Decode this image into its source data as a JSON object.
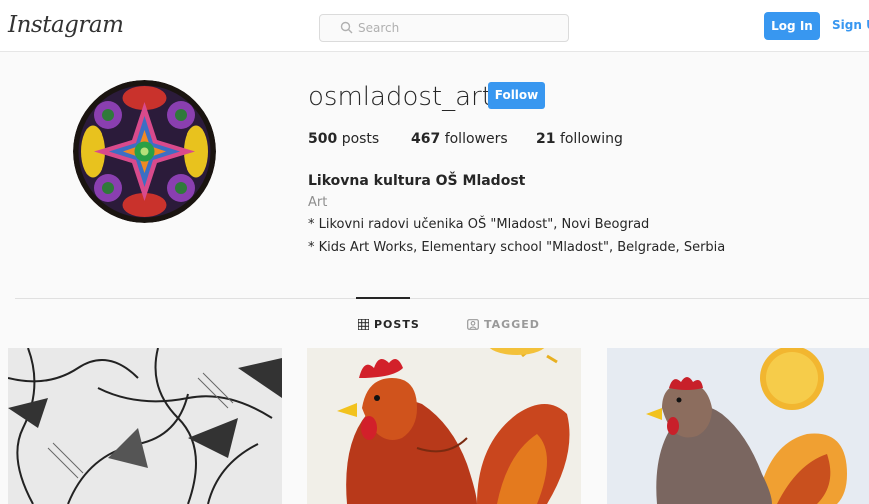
{
  "header": {
    "logo": "Instagram",
    "search_placeholder": "Search",
    "login_label": "Log In",
    "signup_label": "Sign Up"
  },
  "profile": {
    "username": "osmladost_art",
    "follow_label": "Follow",
    "stats": {
      "posts_count": "500",
      "posts_label": "posts",
      "followers_count": "467",
      "followers_label": "followers",
      "following_count": "21",
      "following_label": "following"
    },
    "full_name": "Likovna kultura OŠ Mladost",
    "category": "Art",
    "bio": [
      "* Likovni radovi učenika OŠ \"Mladost\", Novi Beograd",
      "* Kids Art Works, Elementary school \"Mladost\", Belgrade, Serbia"
    ]
  },
  "tabs": [
    {
      "label": "POSTS",
      "icon": "grid-icon",
      "active": true
    },
    {
      "label": "TAGGED",
      "icon": "tagged-icon",
      "active": false
    }
  ],
  "posts": [
    {
      "subject": "pencil-sketch-drawing"
    },
    {
      "subject": "rooster-drawing"
    },
    {
      "subject": "hen-drawing"
    }
  ],
  "colors": {
    "accent": "#3897f0",
    "text": "#262626",
    "muted": "#8e8e8e",
    "background": "#fafafa"
  }
}
